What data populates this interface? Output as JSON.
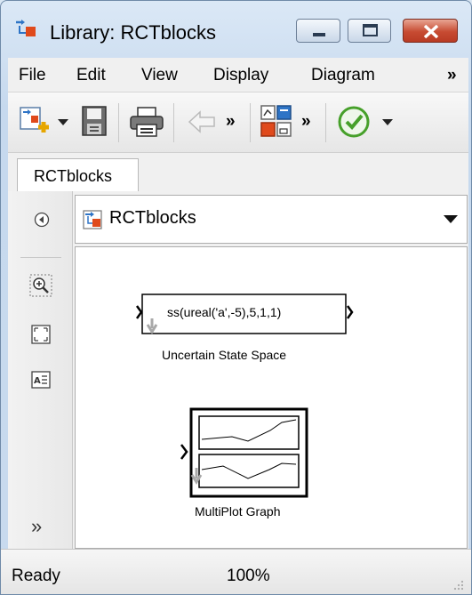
{
  "window": {
    "title": "Library: RCTblocks"
  },
  "menu": {
    "items": [
      "File",
      "Edit",
      "View",
      "Display",
      "Diagram"
    ],
    "overflow": "»"
  },
  "toolbar": {
    "icons": [
      "new-model-icon",
      "dropdown-arrow-icon",
      "save-icon",
      "print-icon",
      "back-icon",
      "overflow-icon",
      "library-browser-icon",
      "overflow-icon",
      "check-icon",
      "dropdown-arrow-icon"
    ],
    "overflow": "»"
  },
  "tabs": [
    {
      "label": "RCTblocks"
    }
  ],
  "address": {
    "path": "RCTblocks"
  },
  "blocks": [
    {
      "name": "Uncertain State Space",
      "content": "ss(ureal('a',-5),5,1,1)"
    },
    {
      "name": "MultiPlot Graph",
      "content": ""
    }
  ],
  "left_tools": {
    "overflow": "»"
  },
  "status": {
    "state": "Ready",
    "zoom": "100%"
  },
  "colors": {
    "accent": "#2e74c6",
    "close_button": "#c74b32",
    "check": "#46a02a"
  }
}
